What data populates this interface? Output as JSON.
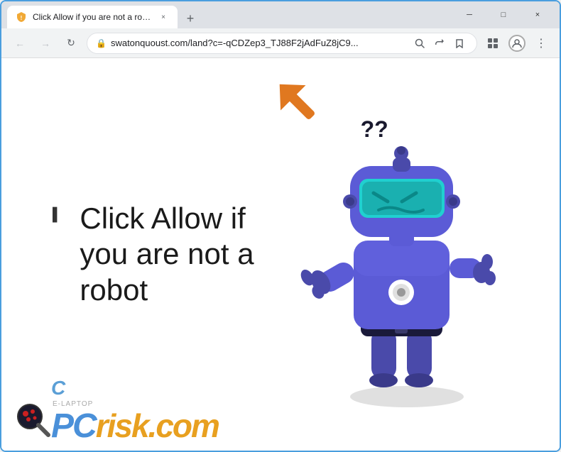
{
  "browser": {
    "title": "Click Allow if you are not a robot",
    "tab_close": "×",
    "new_tab": "+",
    "win_minimize": "─",
    "win_maximize": "□",
    "win_close": "×",
    "nav_back": "←",
    "nav_forward": "→",
    "nav_reload": "↻",
    "address": "swatonquoust.com/land?c=-qCDZep3_TJ88F2jAdFuZ8jC9...",
    "lock_icon": "🔒",
    "menu_dots": "⋮"
  },
  "page": {
    "main_text_line1": "Click Allow if",
    "main_text_line2": "you are not a",
    "main_text_line3": "robot",
    "question_marks": "??",
    "footer_pc": "PC",
    "footer_risk": "risk.com",
    "laptop_label": "E-LAPTOP"
  },
  "colors": {
    "arrow": "#e07820",
    "robot_body": "#5b5bd6",
    "robot_head": "#5b5bd6",
    "robot_visor": "#2ecfcf",
    "robot_shadow": "#d0d0d0",
    "question_mark_color": "#1a1a2e",
    "text_color": "#1a1a1a"
  }
}
